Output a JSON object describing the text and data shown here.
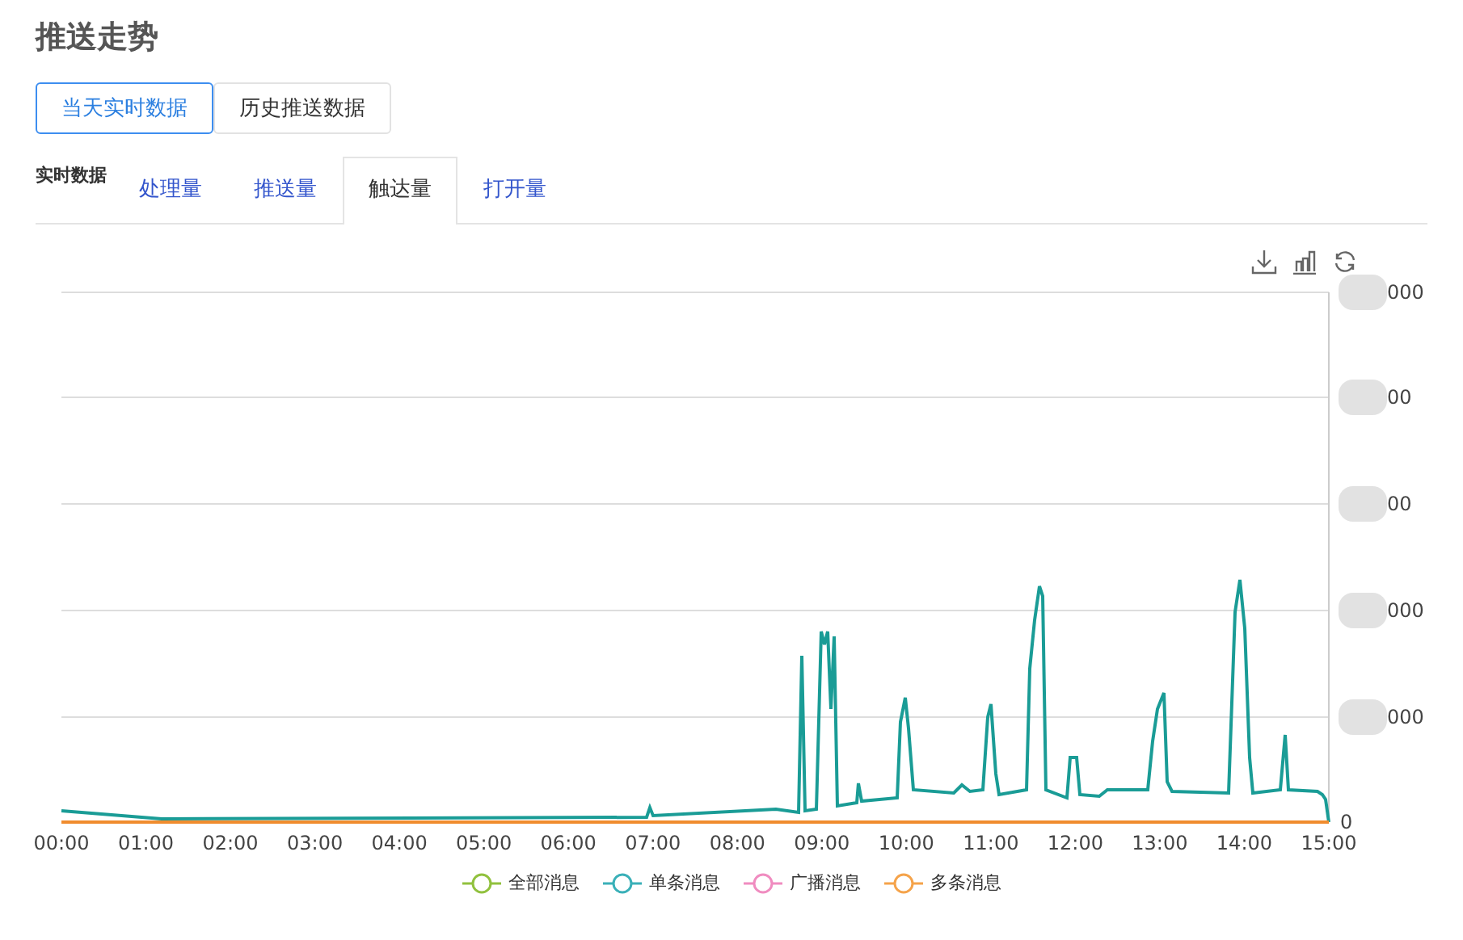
{
  "title": "推送走势",
  "view_buttons": [
    {
      "label": "当天实时数据",
      "selected": true
    },
    {
      "label": "历史推送数据",
      "selected": false
    }
  ],
  "section_label": "实时数据",
  "tabs": [
    {
      "label": "处理量",
      "selected": false
    },
    {
      "label": "推送量",
      "selected": false
    },
    {
      "label": "触达量",
      "selected": true
    },
    {
      "label": "打开量",
      "selected": false
    }
  ],
  "chart": {
    "x_labels": [
      "00:00",
      "01:00",
      "02:00",
      "03:00",
      "04:00",
      "05:00",
      "06:00",
      "07:00",
      "08:00",
      "09:00",
      "10:00",
      "11:00",
      "12:00",
      "13:00",
      "14:00",
      "15:00"
    ],
    "y_labels": [
      "000",
      "00",
      "00",
      "000",
      "000",
      "0"
    ]
  },
  "legend": [
    {
      "label": "全部消息",
      "color": "#91c13e"
    },
    {
      "label": "单条消息",
      "color": "#3ab0b8"
    },
    {
      "label": "广播消息",
      "color": "#f08cc0"
    },
    {
      "label": "多条消息",
      "color": "#f5a34a"
    }
  ]
}
